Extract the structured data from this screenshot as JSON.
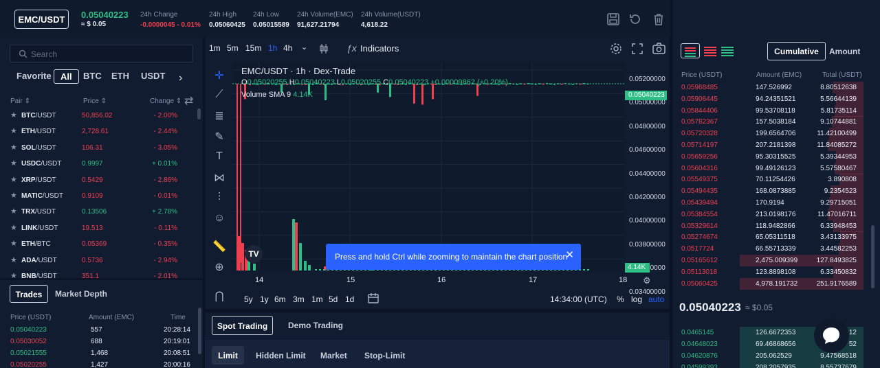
{
  "header": {
    "pair": "EMC/USDT",
    "price": "0.05040223",
    "price_usd": "≈ $ 0.05",
    "stats": [
      {
        "label": "24h Change",
        "value": "-0.0000045 - 0.01%"
      },
      {
        "label": "24h High",
        "value": "0.05060425"
      },
      {
        "label": "24h Low",
        "value": "0.05015589"
      },
      {
        "label": "24h Volume(EMC)",
        "value": "91,627.21794"
      },
      {
        "label": "24h Volume(USDT)",
        "value": "4,618.22"
      }
    ]
  },
  "markets": {
    "search_placeholder": "Search",
    "tabs": [
      "Favorite",
      "All",
      "BTC",
      "ETH",
      "USDT"
    ],
    "headers": [
      "Pair",
      "Price",
      "Change"
    ],
    "rows": [
      {
        "base": "BTC",
        "quote": "/USDT",
        "price": "50,856.02",
        "change": "- 2.00%",
        "dir": "dn"
      },
      {
        "base": "ETH",
        "quote": "/USDT",
        "price": "2,728.61",
        "change": "- 2.44%",
        "dir": "dn"
      },
      {
        "base": "SOL",
        "quote": "/USDT",
        "price": "106.31",
        "change": "- 3.05%",
        "dir": "dn"
      },
      {
        "base": "USDC",
        "quote": "/USDT",
        "price": "0.9997",
        "change": "+ 0.01%",
        "dir": "up"
      },
      {
        "base": "XRP",
        "quote": "/USDT",
        "price": "0.5429",
        "change": "- 2.86%",
        "dir": "dn"
      },
      {
        "base": "MATIC",
        "quote": "/USDT",
        "price": "0.9109",
        "change": "- 0.01%",
        "dir": "dn"
      },
      {
        "base": "TRX",
        "quote": "/USDT",
        "price": "0.13506",
        "change": "+ 2.78%",
        "dir": "up"
      },
      {
        "base": "LINK",
        "quote": "/USDT",
        "price": "19.513",
        "change": "- 0.11%",
        "dir": "dn"
      },
      {
        "base": "ETH",
        "quote": "/BTC",
        "price": "0.05369",
        "change": "- 0.35%",
        "dir": "dn"
      },
      {
        "base": "ADA",
        "quote": "/USDT",
        "price": "0.5736",
        "change": "- 2.94%",
        "dir": "dn"
      },
      {
        "base": "BNB",
        "quote": "/USDT",
        "price": "351.1",
        "change": "- 2.01%",
        "dir": "dn"
      }
    ]
  },
  "trades": {
    "tabs": [
      "Trades",
      "Market Depth"
    ],
    "headers": [
      "Price (USDT)",
      "Amount (EMC)",
      "Time"
    ],
    "rows": [
      {
        "price": "0.05040223",
        "amount": "557",
        "time": "20:28:14",
        "dir": "up"
      },
      {
        "price": "0.05030052",
        "amount": "688",
        "time": "20:19:01",
        "dir": "dn"
      },
      {
        "price": "0.05021555",
        "amount": "1,468",
        "time": "20:08:51",
        "dir": "up"
      },
      {
        "price": "0.05020255",
        "amount": "1,427",
        "time": "20:00:16",
        "dir": "dn"
      }
    ]
  },
  "chart": {
    "intervals": [
      "1m",
      "5m",
      "15m",
      "1h",
      "4h"
    ],
    "active_interval": "1h",
    "indicators_label": "Indicators",
    "title": "EMC/USDT · 1h · Dex-Trade",
    "ohlc": {
      "o": "0.05020255",
      "h": "0.05040223",
      "l": "0.05020255",
      "c": "0.05040223",
      "chg": "+0.00009862 (+0.20%)"
    },
    "volume_label": "Volume SMA 9",
    "volume_value": "4.14K",
    "price_axis": [
      "0.05200000",
      "0.05000000",
      "0.04800000",
      "0.04600000",
      "0.04400000",
      "0.04200000",
      "0.04000000",
      "0.03800000",
      "0.03600000",
      "0.03400000"
    ],
    "last_price_tag": "0.05040223",
    "volume_tag": "4.14K",
    "time_axis": [
      "14",
      "15",
      "16",
      "17",
      "18"
    ],
    "ranges": [
      "5y",
      "1y",
      "6m",
      "3m",
      "1m",
      "5d",
      "1d"
    ],
    "clock": "14:34:00 (UTC)",
    "pct": "%",
    "log": "log",
    "auto": "auto",
    "toast": "Press and hold Ctrl while zooming to maintain the chart position"
  },
  "chart_data": {
    "type": "candlestick",
    "series": [
      {
        "values": [
          0.0504,
          0.0503,
          0.0494,
          0.0504,
          0.0496,
          0.0504,
          0.0489,
          0.0504,
          0.0496,
          0.0504,
          0.0504,
          0.0492,
          0.0504,
          0.0493,
          0.0504,
          0.0488,
          0.0504
        ]
      }
    ],
    "ylim": [
      0.0334,
      0.0524
    ],
    "volumes": [
      4.14
    ]
  },
  "spot": {
    "tabs": [
      "Spot Trading",
      "Demo Trading"
    ],
    "order_types": [
      "Limit",
      "Hidden Limit",
      "Market",
      "Stop-Limit"
    ]
  },
  "orderbook": {
    "modes": [
      "Cumulative",
      "Amount"
    ],
    "headers": [
      "Price (USDT)",
      "Amount (EMC)",
      "Total (USDT)"
    ],
    "asks": [
      [
        "0.05968485",
        "147.526992",
        "8.80512638"
      ],
      [
        "0.05906445",
        "94.24351521",
        "5.56644139"
      ],
      [
        "0.05844406",
        "99.53708118",
        "5.81735114"
      ],
      [
        "0.05782367",
        "157.5038184",
        "9.10744881"
      ],
      [
        "0.05720328",
        "199.6564706",
        "11.42100499"
      ],
      [
        "0.05714197",
        "207.2181398",
        "11.84085272"
      ],
      [
        "0.05659256",
        "95.30315525",
        "5.39344953"
      ],
      [
        "0.05604316",
        "99.49126123",
        "5.57580467"
      ],
      [
        "0.05549375",
        "70.11254426",
        "3.890808"
      ],
      [
        "0.05494435",
        "168.0873885",
        "9.2354523"
      ],
      [
        "0.05439494",
        "170.9194",
        "9.29715051"
      ],
      [
        "0.05384554",
        "213.0198176",
        "11.47016711"
      ],
      [
        "0.05329614",
        "118.9482866",
        "6.33948453"
      ],
      [
        "0.05274674",
        "65.05311518",
        "3.43133975"
      ],
      [
        "0.0517724",
        "66.55713339",
        "3.44582253"
      ],
      [
        "0.05165612",
        "2,475.009399",
        "127.8493825"
      ],
      [
        "0.05113018",
        "123.8898108",
        "6.33450832"
      ],
      [
        "0.05060425",
        "4,978.191732",
        "251.9176589"
      ]
    ],
    "mid_price": "0.05040223",
    "mid_usd": "≈ $0.05",
    "bids": [
      [
        "0.0465145",
        "126.6672353",
        "12"
      ],
      [
        "0.04648023",
        "69.46868656",
        "52"
      ],
      [
        "0.04620876",
        "205.062529",
        "9.47568518"
      ],
      [
        "0.04599393",
        "208.2057935",
        "8.55737679"
      ]
    ]
  },
  "colors": {
    "up": "#2ebd85",
    "down": "#f0404f",
    "accent": "#2962ff"
  }
}
